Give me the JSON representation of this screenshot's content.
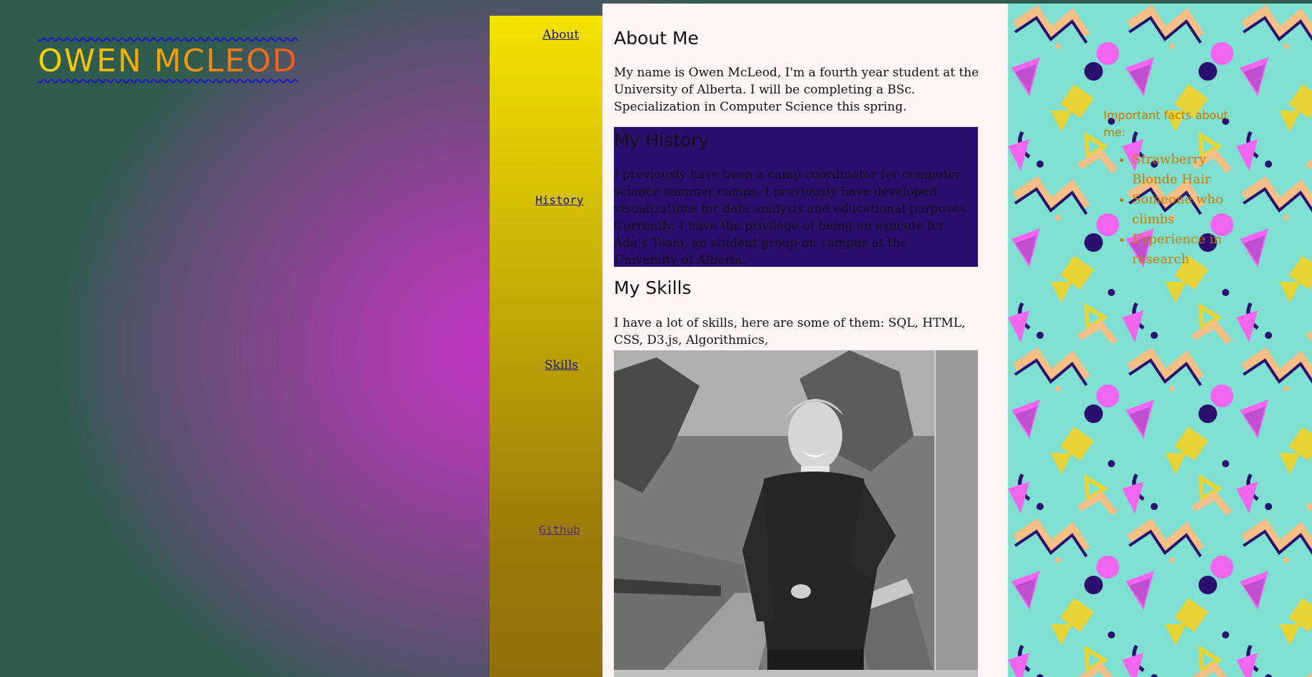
{
  "site": {
    "title": "OWEN MCLEOD"
  },
  "nav": {
    "about": "About",
    "history": "History",
    "skills": "Skills",
    "github": "Github"
  },
  "main": {
    "about_heading": "About Me",
    "about_text": "My name is Owen McLeod, I'm a fourth year student at the University of Alberta. I will be completing a BSc. Specialization in Computer Science this spring.",
    "history_heading": "My History",
    "history_text": "I previously have been a camp coordinator for computer science summer camps. I previously have developed visualizations for data analysis and educational purposes. Currently, I have the privilege of being an execute for Ada's Team, an student group on campus at the University of Alberta.",
    "skills_heading": "My Skills",
    "skills_text": "I have a lot of skills, here are some of them: SQL, HTML, CSS, D3.js, Algorithmics,"
  },
  "aside": {
    "facts_title": "Important facts about me:",
    "facts": [
      "Strawberry Blonde Hair",
      "Someone who climbs",
      "Experience in research"
    ]
  },
  "colors": {
    "nav_top": "#f3e300",
    "nav_bottom": "#93700b",
    "history_bg": "#2a0f6e",
    "aside_bg": "#7fe0d2",
    "title_gradient_start": "#f1d600",
    "title_gradient_end": "#ef5a1e",
    "accent_text": "#c07a00"
  }
}
